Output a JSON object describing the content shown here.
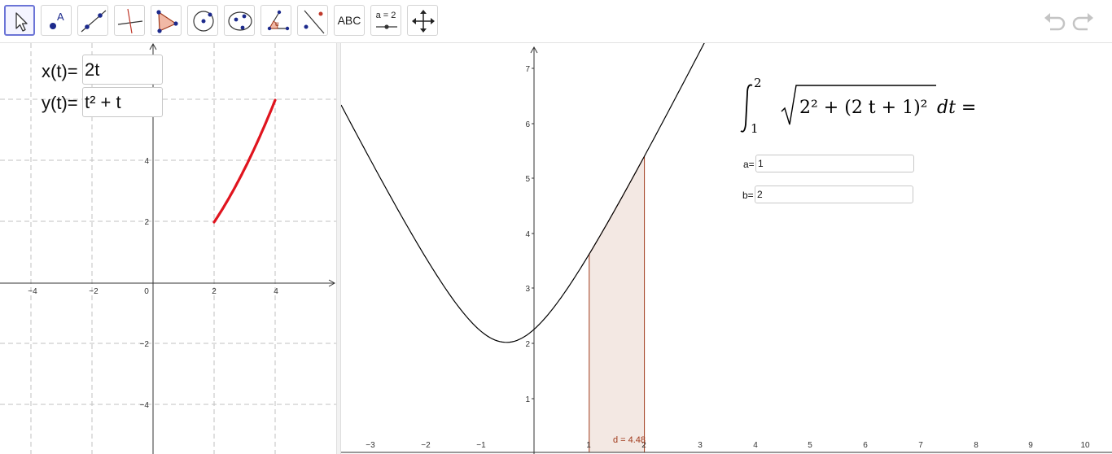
{
  "toolbar": {
    "tools": [
      {
        "id": "move",
        "name": "move-tool-button",
        "icon": "cursor-arrow-icon"
      },
      {
        "id": "point",
        "name": "point-tool-button",
        "icon": "point-icon",
        "label": "A"
      },
      {
        "id": "line",
        "name": "line-tool-button",
        "icon": "line-through-points-icon"
      },
      {
        "id": "perpendicular",
        "name": "perpendicular-line-tool-button",
        "icon": "perpendicular-line-icon"
      },
      {
        "id": "polygon",
        "name": "polygon-tool-button",
        "icon": "polygon-icon"
      },
      {
        "id": "circle",
        "name": "circle-tool-button",
        "icon": "circle-center-point-icon"
      },
      {
        "id": "conic",
        "name": "conic-tool-button",
        "icon": "ellipse-icon"
      },
      {
        "id": "angle",
        "name": "angle-tool-button",
        "icon": "angle-icon",
        "label": "α"
      },
      {
        "id": "reflect",
        "name": "reflect-tool-button",
        "icon": "reflect-about-line-icon"
      },
      {
        "id": "text",
        "name": "text-tool-button",
        "icon": "text-icon",
        "label": "ABC"
      },
      {
        "id": "slider",
        "name": "slider-tool-button",
        "icon": "slider-icon",
        "label": "a = 2"
      },
      {
        "id": "move-view",
        "name": "move-graphics-view-button",
        "icon": "move-arrows-icon"
      }
    ],
    "undo_icon": "undo-icon",
    "redo_icon": "redo-icon"
  },
  "view1": {
    "x_input": {
      "label": "x(t)=",
      "value": "2t"
    },
    "y_input": {
      "label": "y(t)=",
      "value": "t² + t"
    },
    "x_ticks": [
      "−4",
      "−2",
      "0",
      "2",
      "4"
    ],
    "y_ticks": [
      "4",
      "2",
      "−2",
      "−4"
    ],
    "curve_color": "#e0141e"
  },
  "view2": {
    "x_ticks": [
      "−3",
      "−2",
      "−1",
      "1",
      "2",
      "3",
      "4",
      "5",
      "6",
      "7",
      "8",
      "9",
      "10"
    ],
    "y_ticks": [
      "7",
      "6",
      "5",
      "4",
      "3",
      "2",
      "1"
    ],
    "integral_label": "d = 4.48",
    "a_input": {
      "label": "a=",
      "value": "1"
    },
    "b_input": {
      "label": "b=",
      "value": "2"
    },
    "formula": {
      "lower": "1",
      "upper": "2",
      "integrand": "2² + (2 t + 1)²",
      "suffix": "dt ="
    },
    "shade_color": "#f3e8e3",
    "shade_border": "#a0391b",
    "label_color": "#a0391b"
  }
}
